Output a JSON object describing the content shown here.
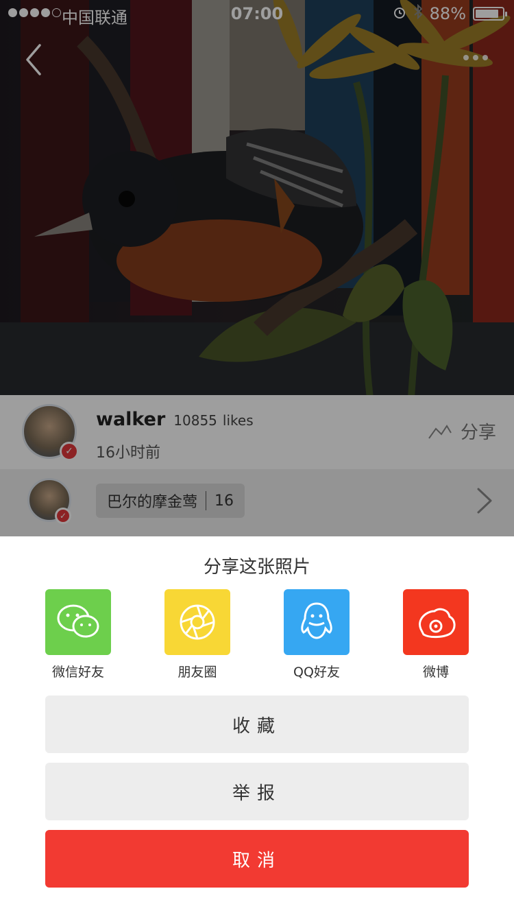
{
  "status_bar": {
    "carrier": "中国联通",
    "time": "07:00",
    "battery_percent": "88%",
    "battery_level": 0.88
  },
  "post": {
    "username": "walker",
    "likes_count": "10855",
    "likes_unit": "likes",
    "time_ago": "16小时前",
    "share_label": "分享",
    "album_name": "巴尔的摩金莺",
    "album_count": "16"
  },
  "share_sheet": {
    "title": "分享这张照片",
    "options": [
      {
        "label": "微信好友",
        "icon": "wechat-icon",
        "color": "#6dcf4c"
      },
      {
        "label": "朋友圈",
        "icon": "moments-icon",
        "color": "#f8d735"
      },
      {
        "label": "QQ好友",
        "icon": "qq-icon",
        "color": "#36a7f2"
      },
      {
        "label": "微博",
        "icon": "weibo-icon",
        "color": "#f3371f"
      }
    ],
    "favorite_label": "收藏",
    "report_label": "举报",
    "cancel_label": "取消"
  },
  "colors": {
    "cancel": "#f23a32",
    "badge": "#e2383a"
  }
}
